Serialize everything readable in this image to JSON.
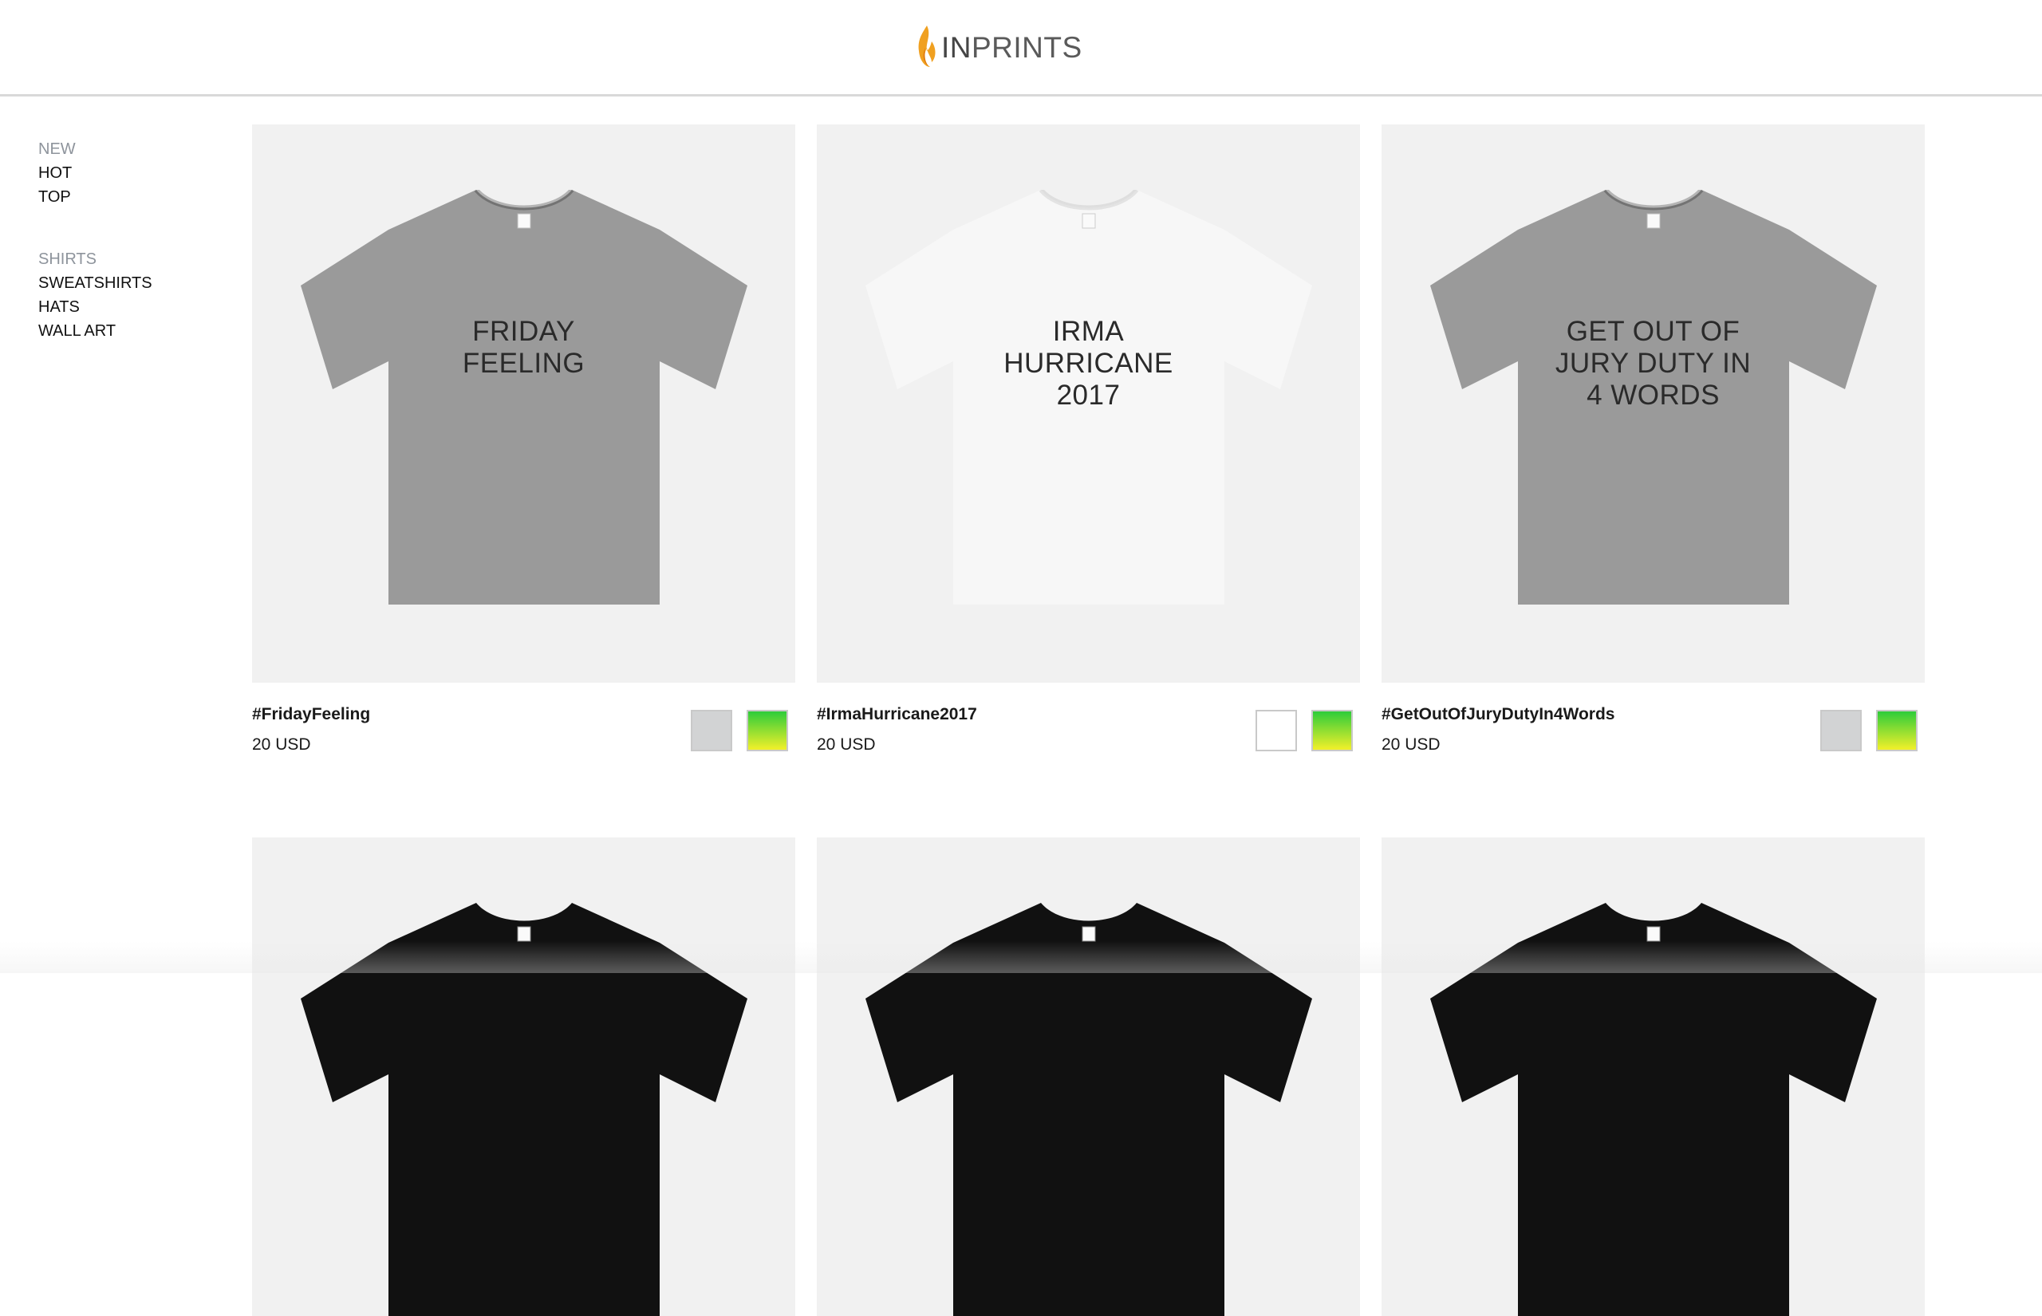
{
  "brand": {
    "prefix": "IN",
    "suffix": "PRINTS",
    "flame_color": "#f0a020"
  },
  "sidebar": {
    "groups": [
      {
        "items": [
          {
            "label": "NEW",
            "active": true
          },
          {
            "label": "HOT"
          },
          {
            "label": "TOP"
          }
        ]
      },
      {
        "items": [
          {
            "label": "SHIRTS",
            "active": true
          },
          {
            "label": "SWEATSHIRTS"
          },
          {
            "label": "HATS"
          },
          {
            "label": "WALL ART"
          }
        ]
      }
    ]
  },
  "products": [
    {
      "title": "#FridayFeeling",
      "price": "20 USD",
      "shirt_color": "#9a9a9a",
      "print_lines": [
        "FRIDAY",
        "FEELING"
      ],
      "swatches": [
        "#d2d3d4",
        "gradient-green-yellow"
      ]
    },
    {
      "title": "#IrmaHurricane2017",
      "price": "20 USD",
      "shirt_color": "#f7f7f7",
      "print_lines": [
        "IRMA",
        "HURRICANE",
        "2017"
      ],
      "swatches": [
        "#ffffff",
        "gradient-green-yellow"
      ]
    },
    {
      "title": "#GetOutOfJuryDutyIn4Words",
      "price": "20 USD",
      "shirt_color": "#9a9a9a",
      "print_lines": [
        "GET OUT OF",
        "JURY DUTY IN",
        "4 WORDS"
      ],
      "swatches": [
        "#d2d3d4",
        "gradient-green-yellow"
      ]
    }
  ],
  "products_row2": [
    {
      "shirt_color": "#111111"
    },
    {
      "shirt_color": "#111111"
    },
    {
      "shirt_color": "#111111"
    }
  ]
}
